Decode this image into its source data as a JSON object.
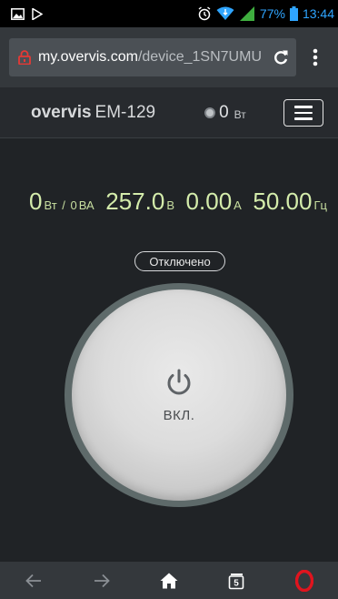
{
  "status_bar": {
    "battery_percent": "77%",
    "time": "13:44"
  },
  "browser": {
    "url_domain": "my.overvis.com",
    "url_path": "/device_1SN7UMU",
    "tab_count": "5"
  },
  "app_header": {
    "brand": "overvis",
    "model": "EM-129",
    "power_value": "0",
    "power_unit": "Вт"
  },
  "readings": {
    "active_power": "0",
    "active_power_unit": "Вт",
    "apparent_power": "0",
    "apparent_power_unit": "ВА",
    "voltage": "257.0",
    "voltage_unit": "В",
    "current": "0.00",
    "current_unit": "А",
    "frequency": "50.00",
    "frequency_unit": "Гц"
  },
  "device_state": {
    "status": "Отключено",
    "button_label": "ВКЛ."
  },
  "colors": {
    "background": "#202326",
    "reading_green": "#d4ecab",
    "accent_blue": "#2fa5ff",
    "lock_red": "#e53935",
    "opera_red": "#e0141e"
  },
  "icons": {
    "status_left": [
      "image-icon",
      "play-store-icon"
    ],
    "status_right": [
      "alarm-icon",
      "wifi-icon",
      "signal-icon",
      "battery-icon"
    ],
    "url_lock": "lock-icon",
    "reload": "reload-icon",
    "overflow": "more-vert-icon",
    "nav": [
      "back-arrow-icon",
      "forward-arrow-icon",
      "home-icon",
      "tabs-icon",
      "opera-icon"
    ]
  }
}
